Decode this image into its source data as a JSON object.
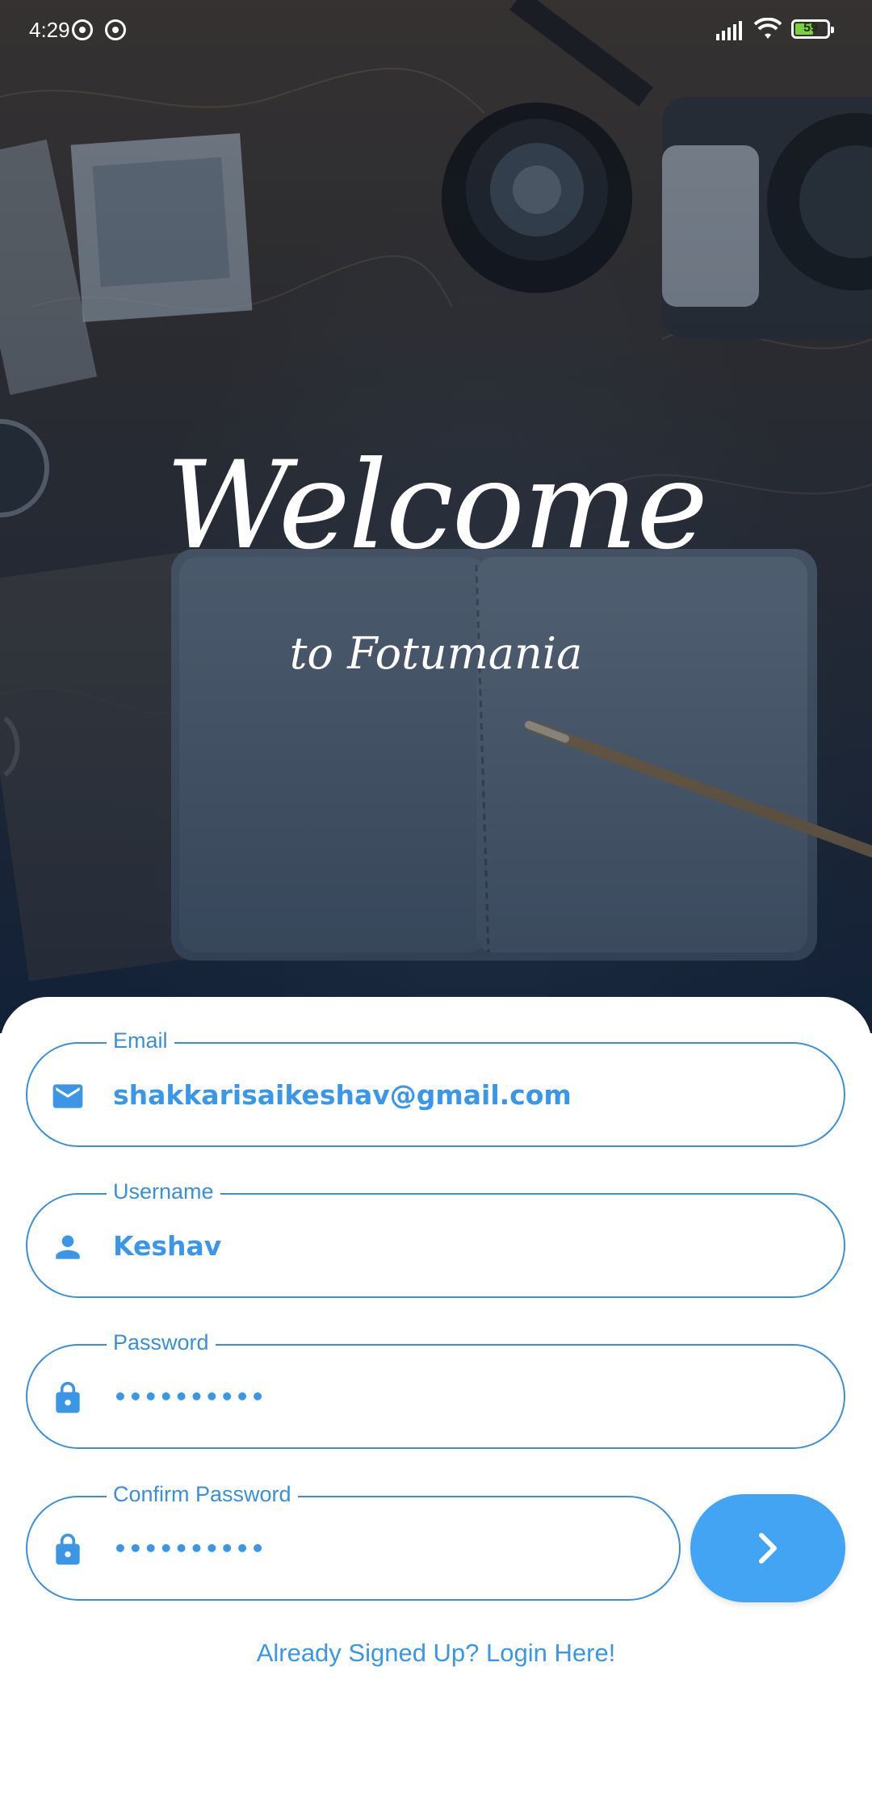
{
  "status_bar": {
    "time": "4:29",
    "battery_level": "59",
    "battery_fraction": 0.59,
    "icons": [
      "app-notification-icon",
      "app-notification-icon",
      "signal-icon",
      "wifi-icon",
      "battery-icon"
    ]
  },
  "hero": {
    "title": "Welcome",
    "subtitle": "to Fotumania"
  },
  "form": {
    "email": {
      "label": "Email",
      "value": "shakkarisaikeshav@gmail.com",
      "icon": "mail-icon"
    },
    "username": {
      "label": "Username",
      "value": "Keshav",
      "icon": "person-icon"
    },
    "password": {
      "label": "Password",
      "value": "••••••••••",
      "icon": "lock-icon"
    },
    "confirm_password": {
      "label": "Confirm Password",
      "value": "••••••••••",
      "icon": "lock-icon"
    },
    "submit_icon": "chevron-right-icon",
    "login_link": "Already Signed Up? Login Here!"
  },
  "colors": {
    "accent": "#3b8fd9",
    "button": "#42a4f2",
    "card_background": "#ffffff"
  }
}
